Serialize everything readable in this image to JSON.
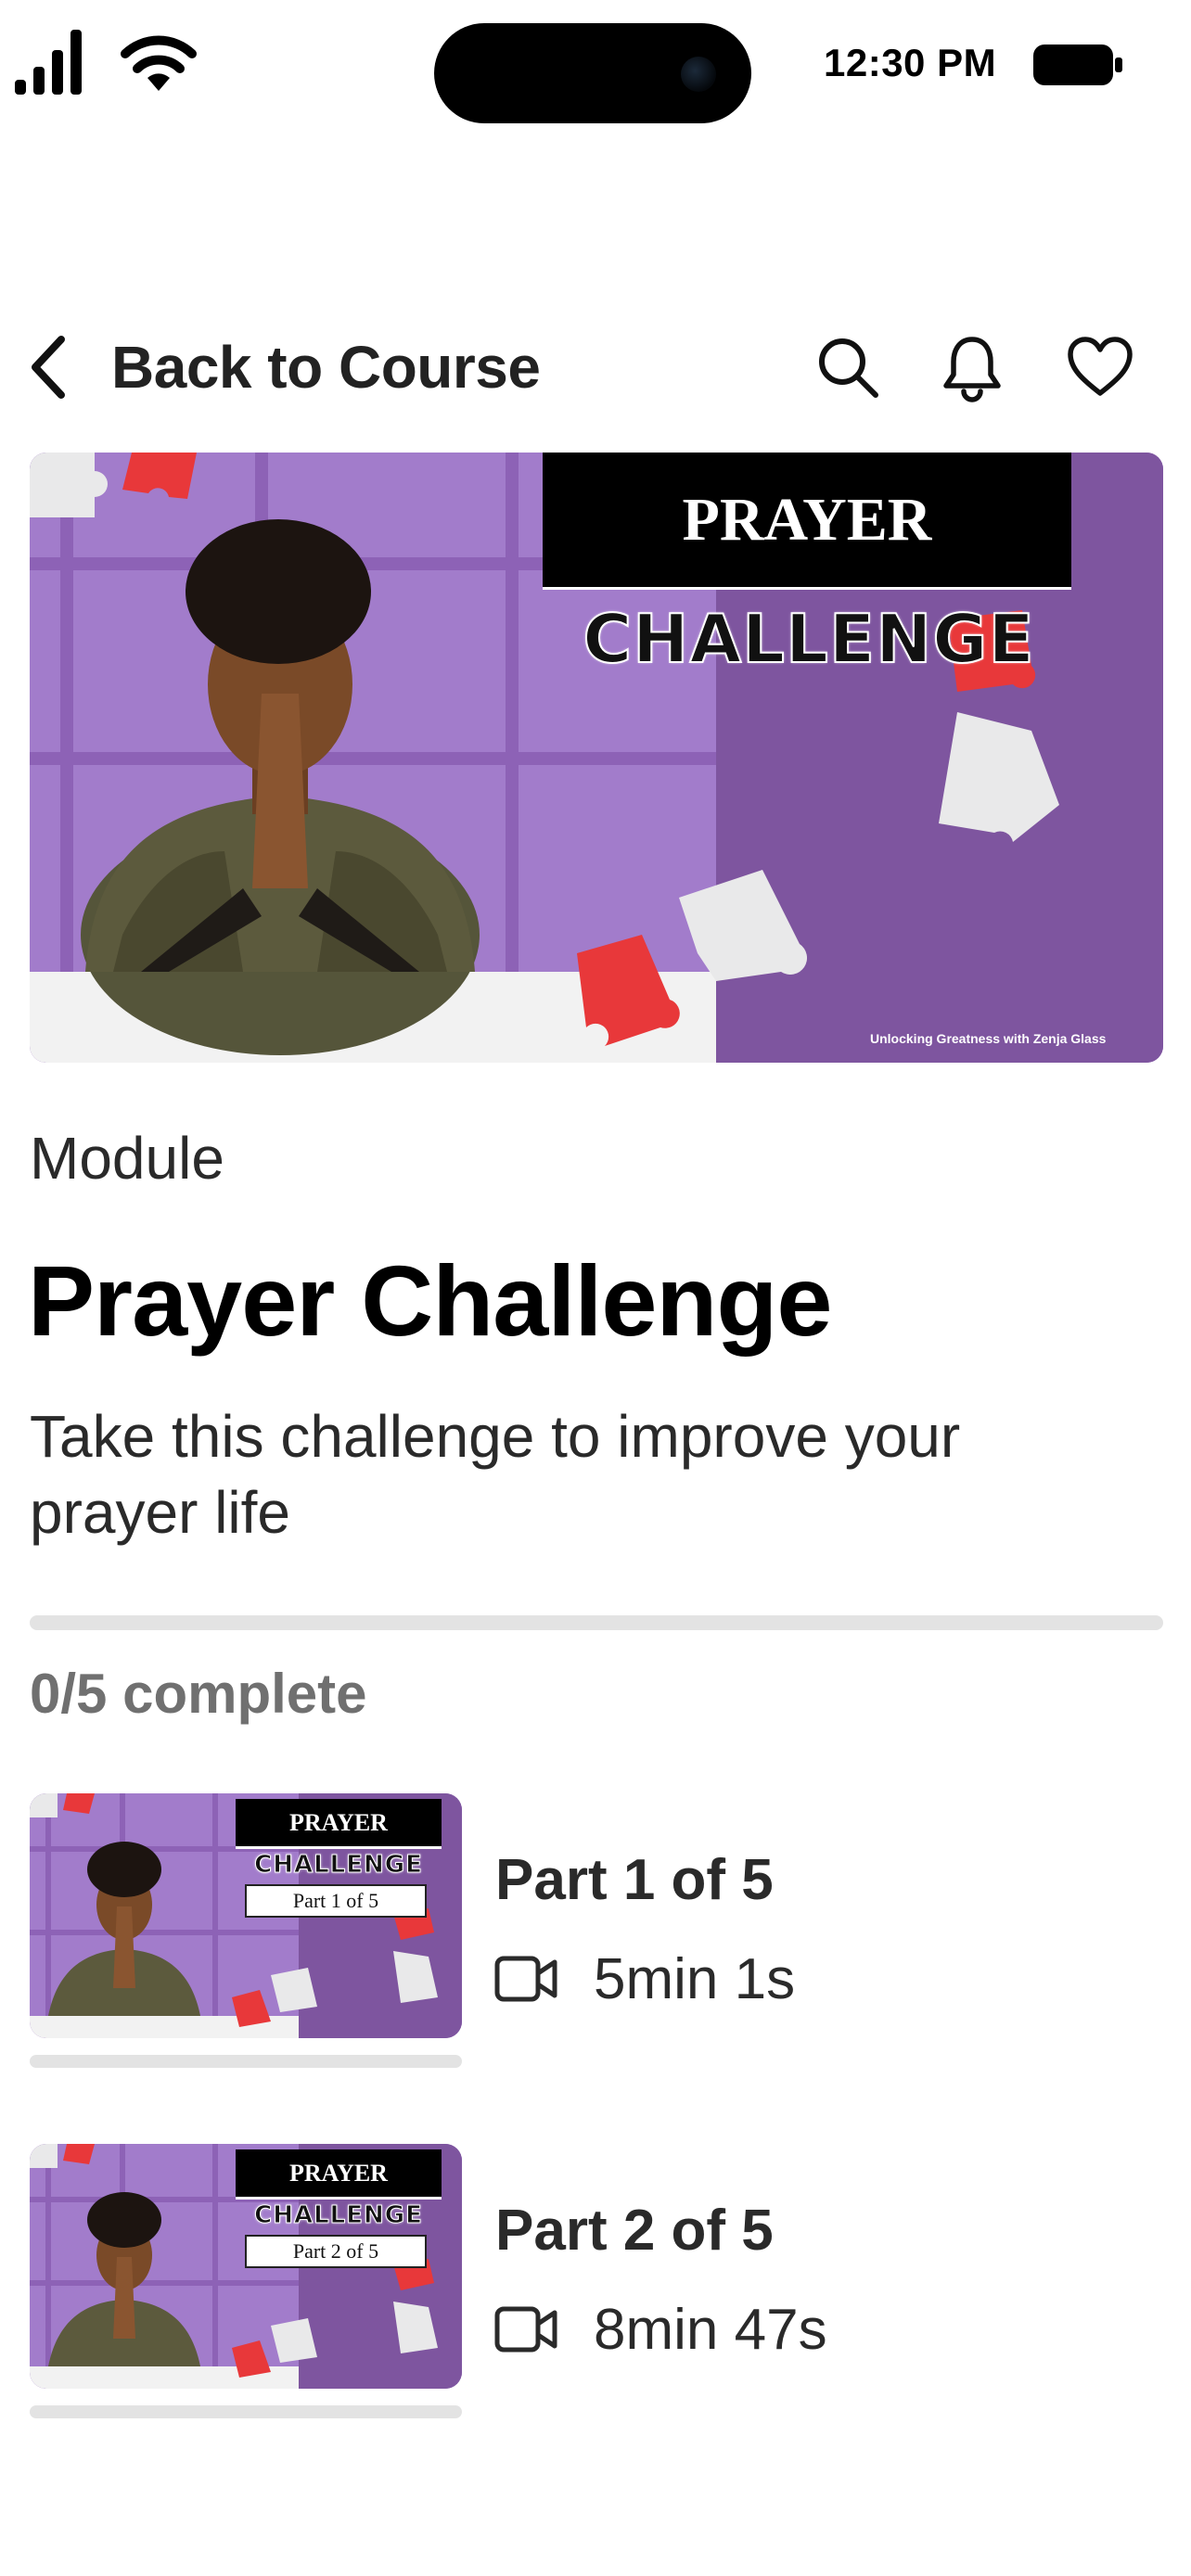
{
  "status_bar": {
    "time": "12:30 PM"
  },
  "nav": {
    "back_label": "Back to Course",
    "icons": [
      "chevron-left-icon",
      "search-icon",
      "bell-icon",
      "heart-icon"
    ]
  },
  "hero": {
    "title_line1": "PRAYER",
    "title_line2": "CHALLENGE",
    "credit": "Unlocking Greatness with Zenja Glass"
  },
  "module": {
    "label": "Module",
    "title": "Prayer Challenge",
    "description": "Take this challenge to improve your prayer life"
  },
  "progress": {
    "text": "0/5 complete",
    "completed": 0,
    "total": 5,
    "fraction": 0
  },
  "lessons": [
    {
      "title": "Part 1 of 5",
      "duration": "5min 1s",
      "thumb_title": "PRAYER",
      "thumb_subtitle": "CHALLENGE",
      "thumb_part": "Part 1 of 5",
      "progress": 0
    },
    {
      "title": "Part 2 of 5",
      "duration": "8min 47s",
      "thumb_title": "PRAYER",
      "thumb_subtitle": "CHALLENGE",
      "thumb_part": "Part 2 of 5",
      "progress": 0
    }
  ],
  "colors": {
    "accent_purple": "#8a5fb0",
    "puzzle_red": "#e8383a",
    "puzzle_white": "#e9e9ea",
    "track": "#e3e3e3"
  }
}
